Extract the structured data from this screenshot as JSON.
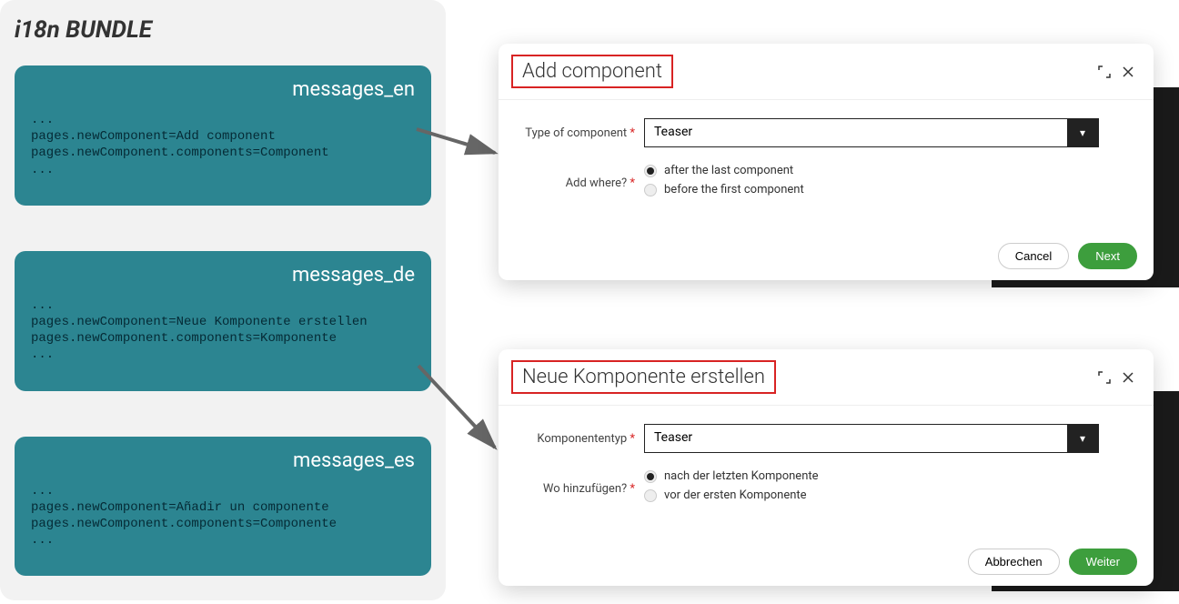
{
  "bundle": {
    "title": "i18n BUNDLE",
    "files": [
      {
        "name": "messages_en",
        "content": "...\npages.newComponent=Add component\npages.newComponent.components=Component\n..."
      },
      {
        "name": "messages_de",
        "content": "...\npages.newComponent=Neue Komponente erstellen\npages.newComponent.components=Komponente\n..."
      },
      {
        "name": "messages_es",
        "content": "...\npages.newComponent=Añadir un componente\npages.newComponent.components=Componente\n..."
      }
    ]
  },
  "dialog_en": {
    "title": "Add component",
    "type_label": "Type of component",
    "type_value": "Teaser",
    "where_label": "Add where?",
    "radio_after": "after the last component",
    "radio_before": "before the first component",
    "cancel": "Cancel",
    "next": "Next"
  },
  "dialog_de": {
    "title": "Neue Komponente erstellen",
    "type_label": "Komponententyp",
    "type_value": "Teaser",
    "where_label": "Wo hinzufügen?",
    "radio_after": "nach der letzten Komponente",
    "radio_before": "vor der ersten Komponente",
    "cancel": "Abbrechen",
    "next": "Weiter"
  }
}
